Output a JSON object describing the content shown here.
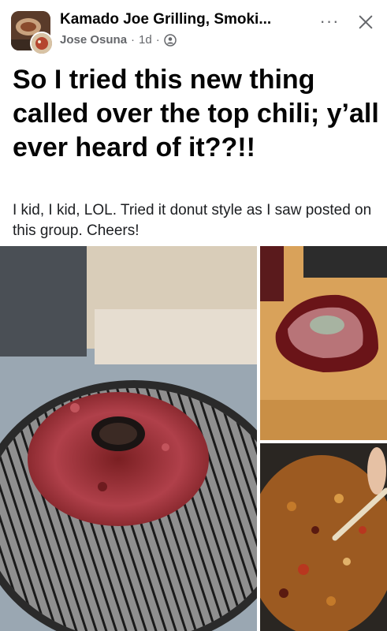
{
  "header": {
    "group_name": "Kamado Joe Grilling, Smoki...",
    "author": "Jose Osuna",
    "separator": "·",
    "time": "1d",
    "separator2": "·",
    "privacy_icon": "group-privacy-icon",
    "more_icon": "more-options-icon",
    "more_label": "···",
    "close_icon": "close-icon"
  },
  "post": {
    "title": "So I tried this new thing called over the top chili; y’all ever heard of it??!!",
    "body": "I kid, I kid, LOL. Tried it donut style as I saw posted on this group.  Cheers!"
  },
  "photos": [
    {
      "name": "donut-meatloaf-on-grill-photo"
    },
    {
      "name": "sliced-smoked-meat-photo"
    },
    {
      "name": "chili-pot-photo"
    }
  ],
  "colors": {
    "text": "#050505",
    "secondary_text": "#65676b",
    "background": "#ffffff"
  }
}
